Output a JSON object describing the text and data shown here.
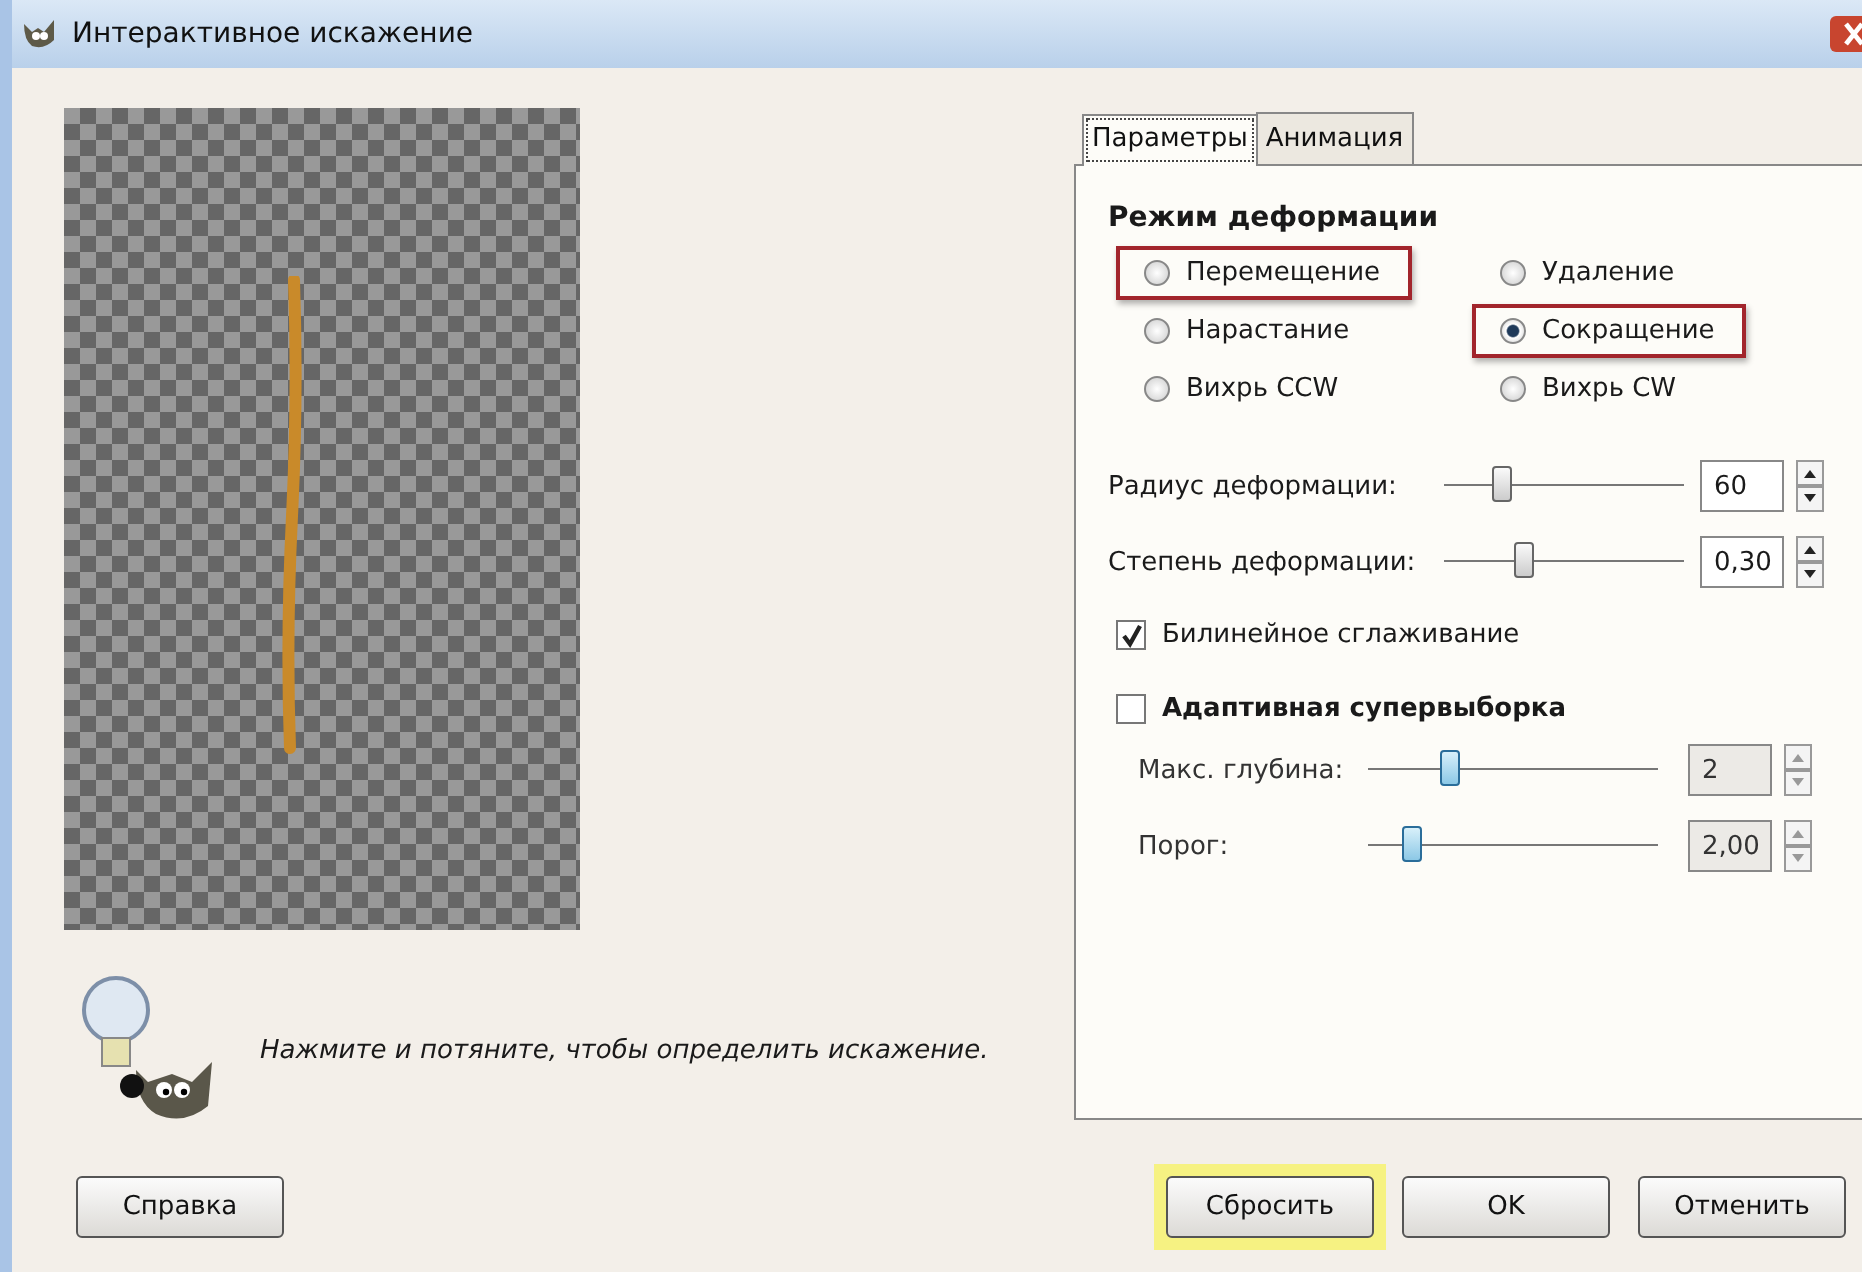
{
  "window": {
    "title": "Интерактивное искажение"
  },
  "preview": {
    "hint": "Нажмите и потяните, чтобы определить искажение."
  },
  "tabs": [
    {
      "label": "Параметры",
      "selected": true
    },
    {
      "label": "Анимация",
      "selected": false
    }
  ],
  "deform_mode": {
    "title": "Режим деформации",
    "options": [
      {
        "label": "Перемещение",
        "selected": false,
        "highlighted": true
      },
      {
        "label": "Удаление",
        "selected": false,
        "highlighted": false
      },
      {
        "label": "Нарастание",
        "selected": false,
        "highlighted": false
      },
      {
        "label": "Сокращение",
        "selected": true,
        "highlighted": true
      },
      {
        "label": "Вихрь CCW",
        "selected": false,
        "highlighted": false
      },
      {
        "label": "Вихрь CW",
        "selected": false,
        "highlighted": false
      }
    ]
  },
  "sliders": [
    {
      "label": "Радиус деформации:",
      "level": 0.24,
      "value": "60",
      "disabled": false
    },
    {
      "label": "Степень деформации:",
      "level": 0.33,
      "value": "0,30",
      "disabled": false
    }
  ],
  "bilinear": {
    "label": "Билинейное сглаживание",
    "checked": true
  },
  "adaptive": {
    "label": "Адаптивная супервыборка",
    "checked": false,
    "sliders": [
      {
        "label": "Макс. глубина:",
        "level": 0.28,
        "value": "2",
        "disabled": true
      },
      {
        "label": "Порог:",
        "level": 0.15,
        "value": "2,00",
        "disabled": true
      }
    ]
  },
  "buttons": [
    {
      "label": "Справка",
      "highlighted": false
    },
    {
      "label": "Сбросить",
      "highlighted": true
    },
    {
      "label": "OK",
      "highlighted": false
    },
    {
      "label": "Отменить",
      "highlighted": false
    }
  ]
}
